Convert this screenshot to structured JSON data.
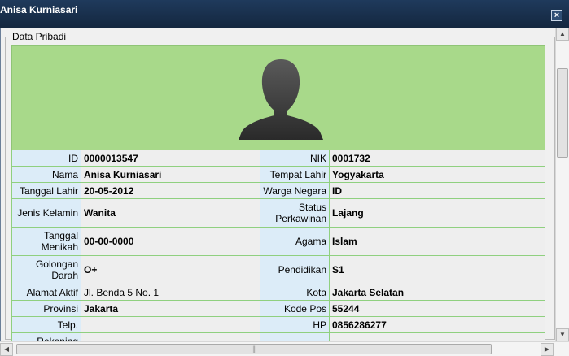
{
  "window": {
    "title": "Anisa Kurniasari",
    "close_label": "×"
  },
  "fieldset": {
    "legend": "Data Pribadi"
  },
  "rows": [
    {
      "l1": "ID",
      "v1": "0000013547",
      "l2": "NIK",
      "v2": "0001732"
    },
    {
      "l1": "Nama",
      "v1": "Anisa Kurniasari",
      "l2": "Tempat Lahir",
      "v2": "Yogyakarta"
    },
    {
      "l1": "Tanggal Lahir",
      "v1": "20-05-2012",
      "l2": "Warga Negara",
      "v2": "ID"
    },
    {
      "l1": "Jenis Kelamin",
      "v1": "Wanita",
      "l2": "Status Perkawinan",
      "v2": "Lajang"
    },
    {
      "l1": "Tanggal Menikah",
      "v1": "00-00-0000",
      "l2": "Agama",
      "v2": "Islam"
    },
    {
      "l1": "Golongan Darah",
      "v1": "O+",
      "l2": "Pendidikan",
      "v2": "S1"
    },
    {
      "l1": "Alamat Aktif",
      "v1": "Jl. Benda 5 No. 1",
      "l2": "Kota",
      "v2": "Jakarta Selatan"
    },
    {
      "l1": "Provinsi",
      "v1": "Jakarta",
      "l2": "Kode Pos",
      "v2": "55244"
    },
    {
      "l1": "Telp.",
      "v1": "",
      "l2": "HP",
      "v2": "0856286277"
    },
    {
      "l1": "Rekening",
      "v1": "",
      "l2": "",
      "v2": ""
    }
  ],
  "scrollbar": {
    "up": "▲",
    "down": "▼",
    "left": "◀",
    "right": "▶",
    "grip": "|||"
  },
  "colors": {
    "titlebar": "#1f3a5c",
    "photo_bg": "#a8d98a",
    "label_bg": "#dcecf8",
    "value_bg": "#eeeeee"
  }
}
